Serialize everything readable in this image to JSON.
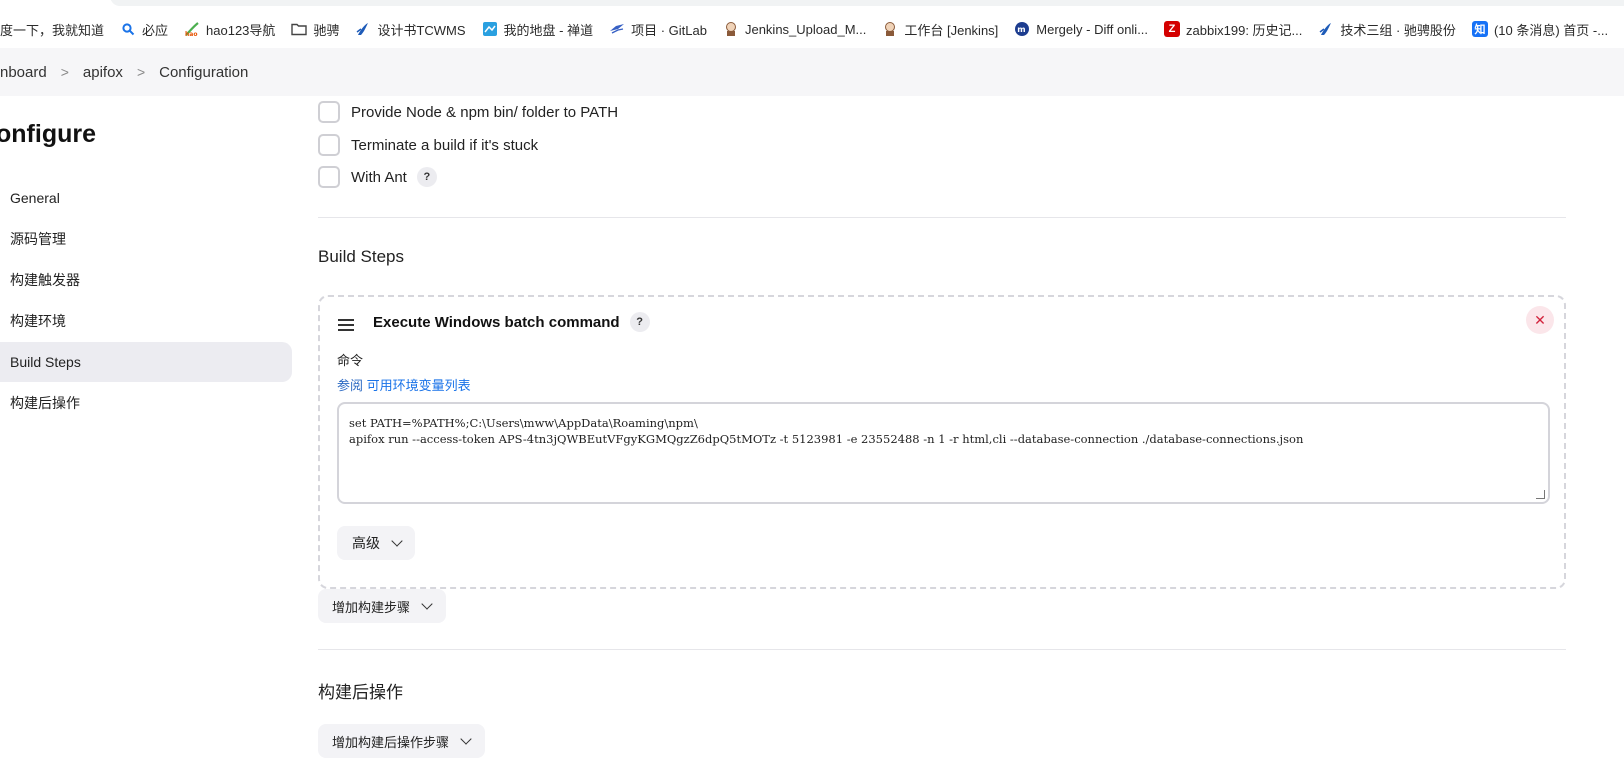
{
  "bookmarks": [
    {
      "icon": "none",
      "label": "度一下，我就知道",
      "icon_color": ""
    },
    {
      "icon": "search-icon",
      "label": "必应",
      "icon_color": "#1a73e8"
    },
    {
      "icon": "hao123-icon",
      "label": "hao123导航",
      "icon_color": "#4caf50"
    },
    {
      "icon": "folder-icon",
      "label": "驰骋",
      "icon_color": "#444444"
    },
    {
      "icon": "logo-icon",
      "label": "设计书TCWMS",
      "icon_color": "#1e5bb8"
    },
    {
      "icon": "cloud-drive-icon",
      "label": "我的地盘 - 禅道",
      "icon_color": "#2aa0e0"
    },
    {
      "icon": "gitlab-icon",
      "label": "项目 · GitLab",
      "icon_color": "#3760c4"
    },
    {
      "icon": "jenkins-icon",
      "label": "Jenkins_Upload_M...",
      "icon_color": "#b07a5a"
    },
    {
      "icon": "jenkins-icon",
      "label": "工作台 [Jenkins]",
      "icon_color": "#b07a5a"
    },
    {
      "icon": "mergely-icon",
      "label": "Mergely - Diff onli...",
      "icon_color": "#1d3d8f"
    },
    {
      "icon": "zabbix-icon",
      "label": "zabbix199: 历史记...",
      "icon_color": "#d40000"
    },
    {
      "icon": "logo-icon",
      "label": "技术三组 · 驰骋股份",
      "icon_color": "#1e5bb8"
    },
    {
      "icon": "zhihu-icon",
      "label": "(10 条消息) 首页 -...",
      "icon_color": "#1772f6"
    }
  ],
  "breadcrumb": {
    "items": [
      "nboard",
      "apifox",
      "Configuration"
    ],
    "separator": ">"
  },
  "sidebar": {
    "title": "onfigure",
    "items": [
      {
        "label": "General",
        "active": false
      },
      {
        "label": "源码管理",
        "active": false
      },
      {
        "label": "构建触发器",
        "active": false
      },
      {
        "label": "构建环境",
        "active": false
      },
      {
        "label": "Build Steps",
        "active": true
      },
      {
        "label": "构建后操作",
        "active": false
      }
    ]
  },
  "build_env": {
    "options": [
      {
        "label": "Provide Node & npm bin/ folder to PATH",
        "checked": false,
        "help": false
      },
      {
        "label": "Terminate a build if it's stuck",
        "checked": false,
        "help": false
      },
      {
        "label": "With Ant",
        "checked": false,
        "help": true
      }
    ],
    "help_glyph": "?"
  },
  "build_steps": {
    "title": "Build Steps",
    "step": {
      "title": "Execute Windows batch command",
      "help_glyph": "?",
      "close_glyph": "✕",
      "command_label": "命令",
      "see_prefix": "参阅",
      "see_link": "可用环境变量列表",
      "command": "set PATH=%PATH%;C:\\Users\\mww\\AppData\\Roaming\\npm\\\napifox run --access-token APS-4tn3jQWBEutVFgyKGMQgzZ6dpQ5tMOTz -t 5123981 -e 23552488 -n 1 -r html,cli --database-connection ./database-connections.json",
      "advanced_label": "高级"
    },
    "add_button_label": "增加构建步骤"
  },
  "post_build": {
    "title": "构建后操作",
    "add_button_label": "增加构建后操作步骤"
  },
  "colors": {
    "active_nav_bg": "#ececf1",
    "link": "#1a73e8",
    "close_bg": "#fbe6ea",
    "close_fg": "#d2233c"
  }
}
